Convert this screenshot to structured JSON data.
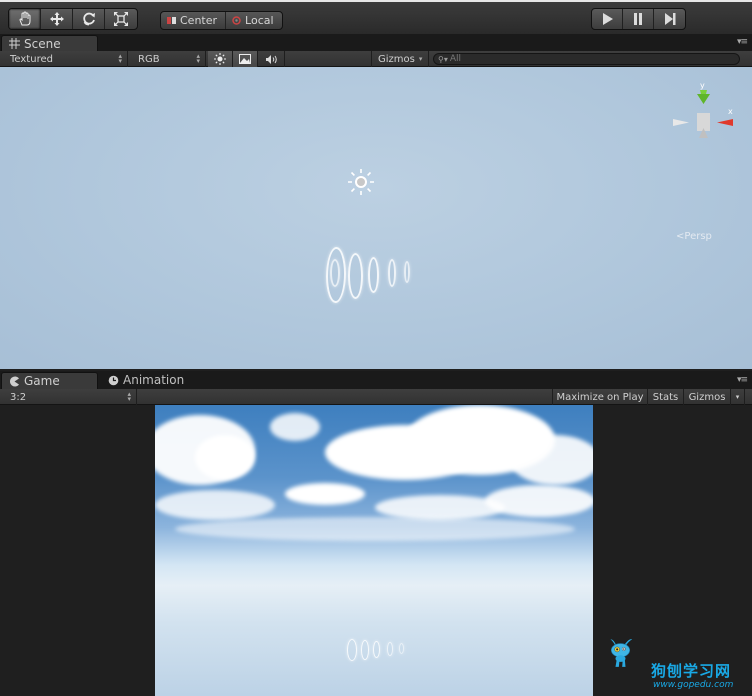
{
  "toolbar": {
    "tools": [
      {
        "name": "hand-tool",
        "icon": "hand-icon"
      },
      {
        "name": "move-tool",
        "icon": "move-arrows-icon"
      },
      {
        "name": "rotate-tool",
        "icon": "rotate-icon"
      },
      {
        "name": "scale-tool",
        "icon": "scale-icon"
      }
    ],
    "pivot_label": "Center",
    "space_label": "Local",
    "playback": [
      "play-icon",
      "pause-icon",
      "step-icon"
    ]
  },
  "scene": {
    "tab_label": "Scene",
    "shading_mode": "Textured",
    "render_mode": "RGB",
    "gizmos_label": "Gizmos",
    "search_placeholder": "All",
    "axis_y": "y",
    "axis_x": "x",
    "projection_label": "Persp"
  },
  "game": {
    "tab_label": "Game",
    "animation_tab_label": "Animation",
    "aspect": "3:2",
    "maximize_label": "Maximize on Play",
    "stats_label": "Stats",
    "gizmos_label": "Gizmos"
  },
  "watermark": {
    "text": "狗刨学习网",
    "url": "www.gopedu.com"
  },
  "colors": {
    "editor_bg": "#1f1f1f",
    "sky_scene": "#b0c7dc",
    "axis_y": "#7ad03a",
    "axis_x": "#e0392b",
    "watermark": "#19a9e6"
  }
}
